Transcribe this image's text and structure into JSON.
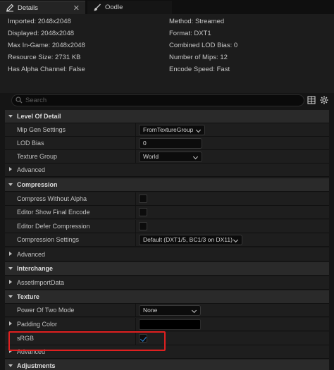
{
  "tabs": [
    {
      "label": "Details",
      "icon": "pencil-icon",
      "active": true,
      "close": "✕"
    },
    {
      "label": "Oodle",
      "icon": "brush-icon",
      "active": false
    }
  ],
  "info": {
    "left": [
      "Imported: 2048x2048",
      "Displayed: 2048x2048",
      "Max In-Game: 2048x2048",
      "Resource Size: 2731 KB",
      "Has Alpha Channel: False"
    ],
    "right": [
      "Method: Streamed",
      "Format: DXT1",
      "Combined LOD Bias: 0",
      "Number of Mips: 12",
      "Encode Speed: Fast"
    ]
  },
  "search": {
    "placeholder": "Search",
    "icon": "search-icon"
  },
  "toolbar": {
    "grid_icon": "grid-view-icon",
    "settings_icon": "gear-icon"
  },
  "sections": {
    "lod": {
      "title": "Level Of Detail",
      "mip_gen": {
        "label": "Mip Gen Settings",
        "value": "FromTextureGroup"
      },
      "lod_bias": {
        "label": "LOD Bias",
        "value": "0"
      },
      "texture_group": {
        "label": "Texture Group",
        "value": "World"
      },
      "advanced": "Advanced"
    },
    "compression": {
      "title": "Compression",
      "compress_without_alpha": {
        "label": "Compress Without Alpha",
        "checked": false
      },
      "editor_show_final_encode": {
        "label": "Editor Show Final Encode",
        "checked": false
      },
      "editor_defer_compression": {
        "label": "Editor Defer Compression",
        "checked": false
      },
      "compression_settings": {
        "label": "Compression Settings",
        "value": "Default (DXT1/5, BC1/3 on DX11)"
      },
      "advanced": "Advanced"
    },
    "interchange": {
      "title": "Interchange",
      "asset_import_data": "AssetImportData"
    },
    "texture": {
      "title": "Texture",
      "power_of_two": {
        "label": "Power Of Two Mode",
        "value": "None"
      },
      "padding_color": {
        "label": "Padding Color",
        "color": "#000000"
      },
      "srgb": {
        "label": "sRGB",
        "checked": true
      },
      "advanced": "Advanced"
    },
    "adjustments": {
      "title": "Adjustments"
    }
  },
  "colors": {
    "accent_check": "#2e8fe5",
    "highlight_box": "#e02020",
    "category_bg": "#2a2a2a",
    "row_bg": "#1e1e1e"
  }
}
